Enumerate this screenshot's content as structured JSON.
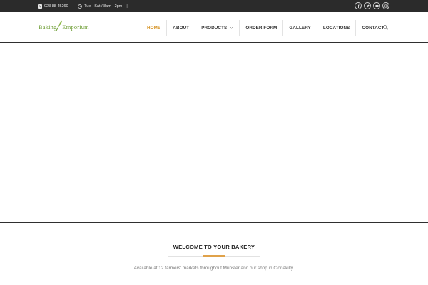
{
  "topbar": {
    "phone": "023 88 45260",
    "hours": "Tue - Sat / 8am - 2pm",
    "separator": "|",
    "phone_icon": "phone-icon",
    "hours_icon": "clock-icon",
    "socials": [
      "facebook-icon",
      "twitter-icon",
      "youtube-icon",
      "instagram-icon"
    ]
  },
  "logo": {
    "part1": "Baking",
    "part2": "Emporium"
  },
  "nav": {
    "items": [
      {
        "label": "HOME"
      },
      {
        "label": "ABOUT"
      },
      {
        "label": "PRODUCTS"
      },
      {
        "label": "ORDER FORM"
      },
      {
        "label": "GALLERY"
      },
      {
        "label": "LOCATIONS"
      },
      {
        "label": "CONTACT"
      }
    ]
  },
  "welcome": {
    "title": "WELCOME TO YOUR BAKERY",
    "text": "Available at 12 farmers' markets throughout Munster and our shop in Clonakilty."
  },
  "colors": {
    "accent": "#d8962a",
    "brand_green": "#6a9b2f",
    "topbar_bg": "#2b2b2b"
  }
}
